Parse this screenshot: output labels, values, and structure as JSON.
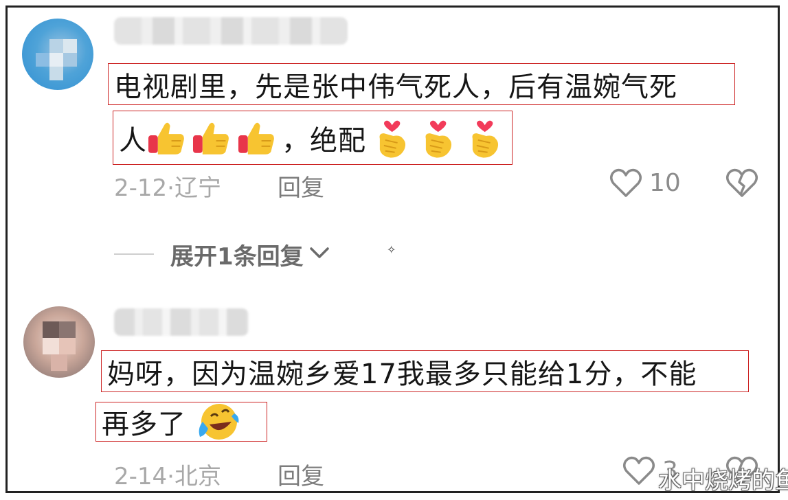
{
  "comments": [
    {
      "text_line1": "电视剧里，先是张中伟气死人，后有温婉气死",
      "text_line2_start": "人",
      "text_line2_mid": "，绝配",
      "emojis": [
        "thumbs-up-icon",
        "heart-hands-icon"
      ],
      "date": "2-12",
      "location": "辽宁",
      "reply_label": "回复",
      "like_count": "10"
    },
    {
      "text_line1": "妈呀，因为温婉乡爱17我最多只能给1分，不能",
      "text_line2": "再多了",
      "emojis": [
        "laughing-crying-icon"
      ],
      "date": "2-14",
      "location": "北京",
      "reply_label": "回复",
      "like_count": "3"
    }
  ],
  "expand_replies": {
    "label": "展开1条回复"
  },
  "meta_separator": "·",
  "watermark": "水中烧烤的鱼",
  "colors": {
    "highlight_border": "#cc2222",
    "muted_text": "#a8a8a8"
  }
}
